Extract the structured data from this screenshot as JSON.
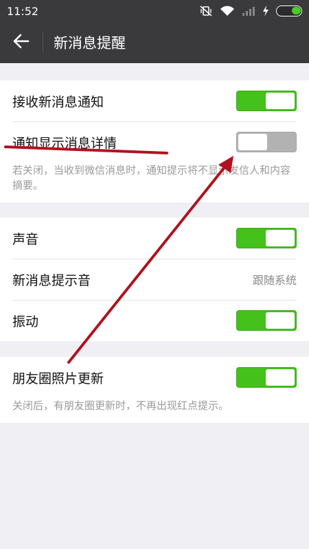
{
  "status_bar": {
    "time": "11:52",
    "icons": [
      "mute-vibrate-icon",
      "wifi-icon",
      "signal-icon",
      "charging-icon",
      "battery-icon"
    ]
  },
  "header": {
    "back_icon": "arrow-left-icon",
    "title": "新消息提醒"
  },
  "groups": {
    "g1": {
      "receive": {
        "label": "接收新消息通知",
        "state": "on"
      },
      "details": {
        "label": "通知显示消息详情",
        "state": "off"
      },
      "hint": "若关闭，当收到微信消息时，通知提示将不显示发信人和内容摘要。"
    },
    "g2": {
      "sound": {
        "label": "声音",
        "state": "on"
      },
      "tone": {
        "label": "新消息提示音",
        "value": "跟随系统"
      },
      "vibrate": {
        "label": "振动",
        "state": "on"
      }
    },
    "g3": {
      "moments": {
        "label": "朋友圈照片更新",
        "state": "on"
      },
      "hint": "关闭后，有朋友圈更新时，不再出现红点提示。"
    }
  },
  "colors": {
    "bar_background": "#3a3a3c",
    "toggle_on": "#44c11a",
    "toggle_off": "#b2b2b2",
    "annotation": "#b0121f"
  }
}
